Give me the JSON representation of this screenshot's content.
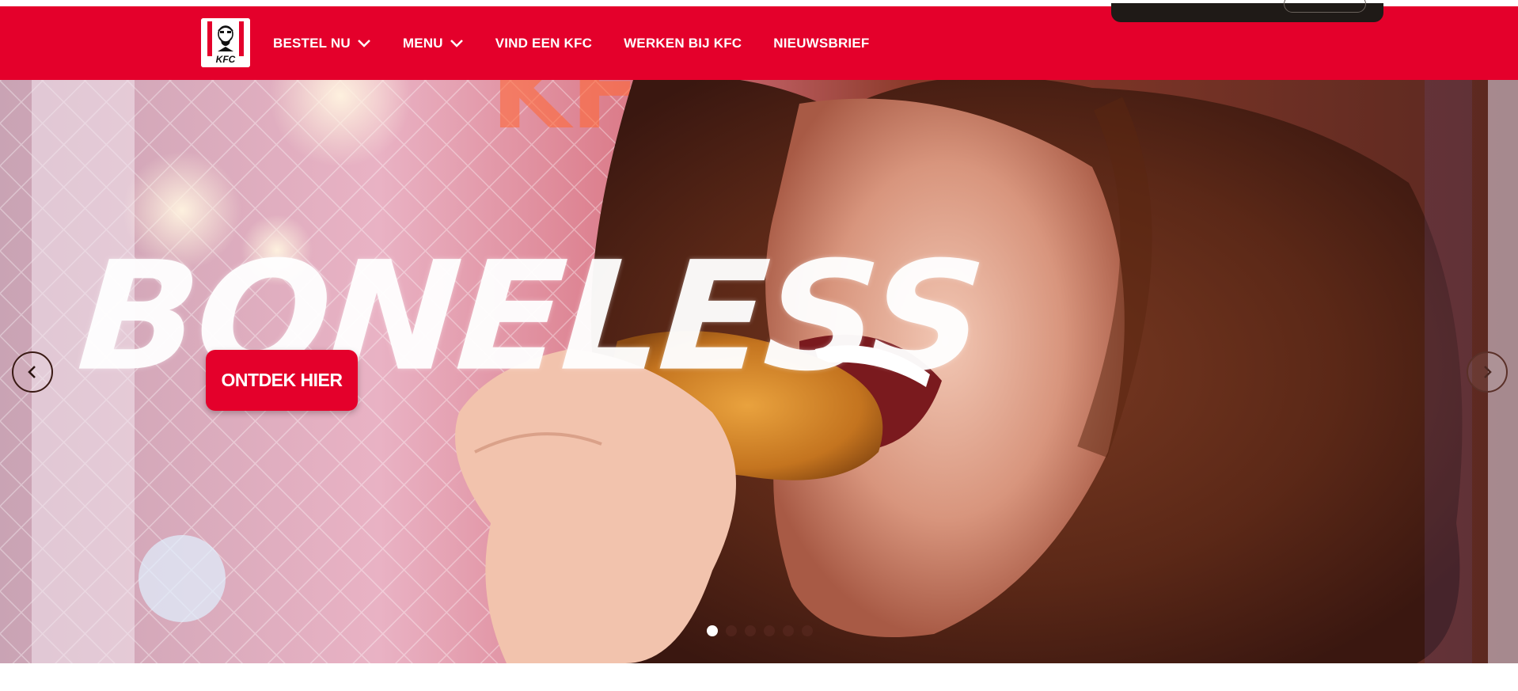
{
  "brand": {
    "name": "KFC",
    "logo_text": "KFC",
    "accent_color": "#e4002b"
  },
  "nav": {
    "items": [
      {
        "label": "BESTEL NU",
        "has_dropdown": true
      },
      {
        "label": "MENU",
        "has_dropdown": true
      },
      {
        "label": "VIND EEN KFC",
        "has_dropdown": false
      },
      {
        "label": "WERKEN BIJ KFC",
        "has_dropdown": false
      },
      {
        "label": "NIEUWSBRIEF",
        "has_dropdown": false
      }
    ]
  },
  "hero": {
    "headline": "BONELESS",
    "cta_label": "ONTDEK HIER",
    "prev_icon": "chevron-left-icon",
    "next_icon": "chevron-right-icon",
    "slide_count": 6,
    "active_slide": 1
  }
}
